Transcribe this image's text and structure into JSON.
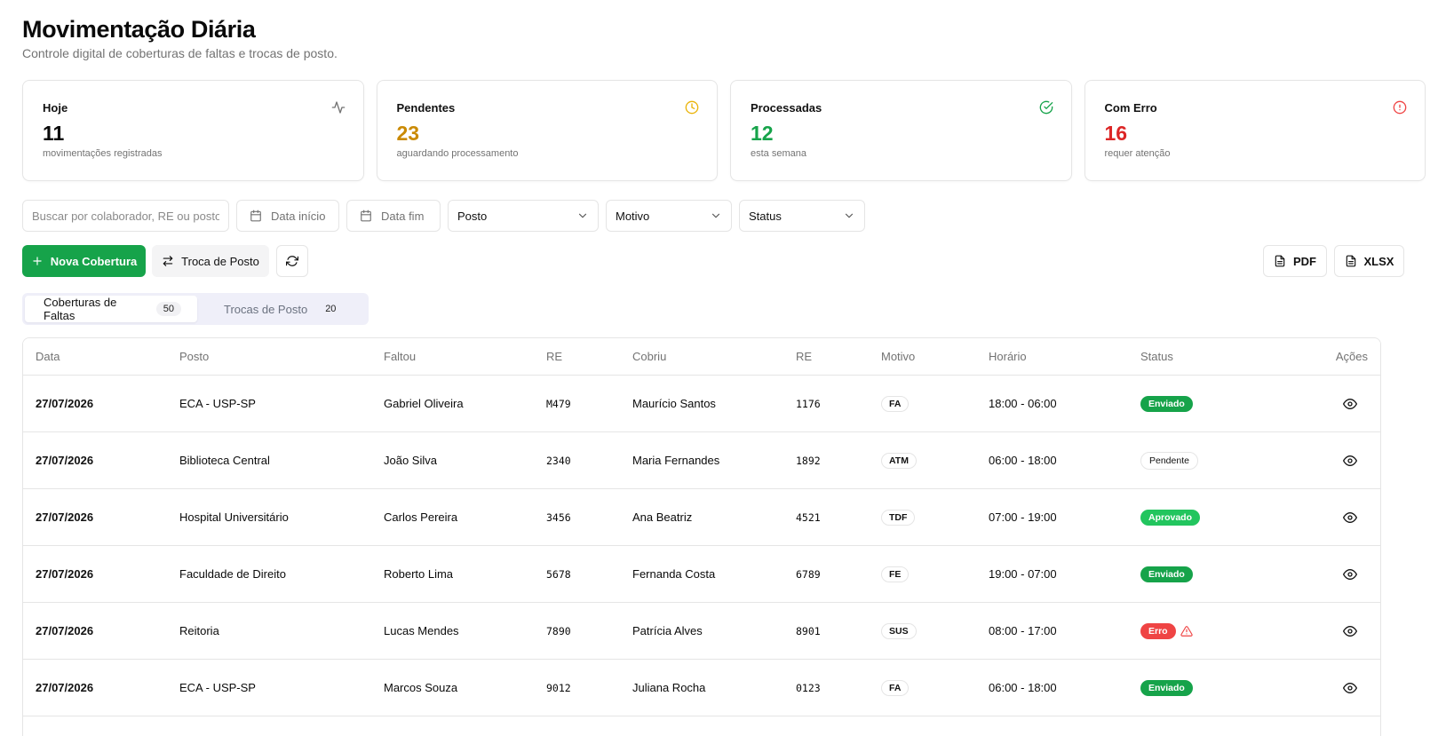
{
  "header": {
    "title": "Movimentação Diária",
    "subtitle": "Controle digital de coberturas de faltas e trocas de posto."
  },
  "stats": [
    {
      "label": "Hoje",
      "value": "11",
      "desc": "movimentações registradas",
      "color": "#0a0a0a",
      "icon": "activity-icon"
    },
    {
      "label": "Pendentes",
      "value": "23",
      "desc": "aguardando processamento",
      "color": "#ca8a04",
      "icon": "clock-icon"
    },
    {
      "label": "Processadas",
      "value": "12",
      "desc": "esta semana",
      "color": "#16a34a",
      "icon": "check-circle-icon"
    },
    {
      "label": "Com Erro",
      "value": "16",
      "desc": "requer atenção",
      "color": "#dc2626",
      "icon": "alert-circle-icon"
    }
  ],
  "filters": {
    "search_placeholder": "Buscar por colaborador, RE ou posto...",
    "date_start": "Data início",
    "date_end": "Data fim",
    "posto": "Posto",
    "motivo": "Motivo",
    "status": "Status"
  },
  "actions": {
    "new_label": "Nova Cobertura",
    "swap_label": "Troca de Posto",
    "pdf_label": "PDF",
    "xlsx_label": "XLSX"
  },
  "tabs": [
    {
      "label": "Coberturas de Faltas",
      "count": "50"
    },
    {
      "label": "Trocas de Posto",
      "count": "20"
    }
  ],
  "table": {
    "columns": [
      "Data",
      "Posto",
      "Faltou",
      "RE",
      "Cobriu",
      "RE",
      "Motivo",
      "Horário",
      "Status",
      "Ações"
    ],
    "rows": [
      {
        "data": "27/07/2026",
        "posto": "ECA - USP-SP",
        "faltou": "Gabriel Oliveira",
        "re1": "M479",
        "cobriu": "Maurício Santos",
        "re2": "1176",
        "motivo": "FA",
        "horario": "18:00 - 06:00",
        "status": "Enviado"
      },
      {
        "data": "27/07/2026",
        "posto": "Biblioteca Central",
        "faltou": "João Silva",
        "re1": "2340",
        "cobriu": "Maria Fernandes",
        "re2": "1892",
        "motivo": "ATM",
        "horario": "06:00 - 18:00",
        "status": "Pendente"
      },
      {
        "data": "27/07/2026",
        "posto": "Hospital Universitário",
        "faltou": "Carlos Pereira",
        "re1": "3456",
        "cobriu": "Ana Beatriz",
        "re2": "4521",
        "motivo": "TDF",
        "horario": "07:00 - 19:00",
        "status": "Aprovado"
      },
      {
        "data": "27/07/2026",
        "posto": "Faculdade de Direito",
        "faltou": "Roberto Lima",
        "re1": "5678",
        "cobriu": "Fernanda Costa",
        "re2": "6789",
        "motivo": "FE",
        "horario": "19:00 - 07:00",
        "status": "Enviado"
      },
      {
        "data": "27/07/2026",
        "posto": "Reitoria",
        "faltou": "Lucas Mendes",
        "re1": "7890",
        "cobriu": "Patrícia Alves",
        "re2": "8901",
        "motivo": "SUS",
        "horario": "08:00 - 17:00",
        "status": "Erro"
      },
      {
        "data": "27/07/2026",
        "posto": "ECA - USP-SP",
        "faltou": "Marcos Souza",
        "re1": "9012",
        "cobriu": "Juliana Rocha",
        "re2": "0123",
        "motivo": "FA",
        "horario": "06:00 - 18:00",
        "status": "Enviado"
      }
    ]
  }
}
